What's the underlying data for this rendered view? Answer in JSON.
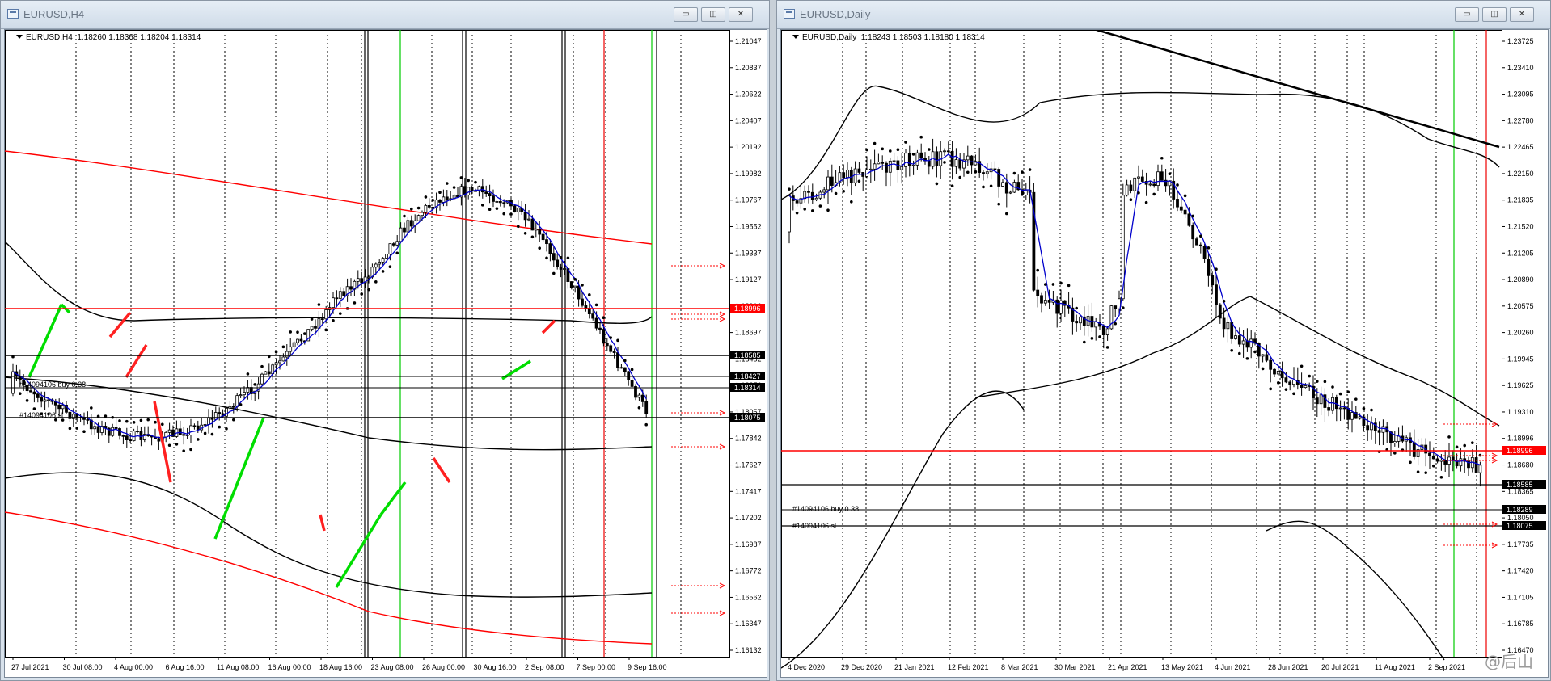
{
  "windows": [
    {
      "title": "EURUSD,H4",
      "header": "EURUSD,H4  1.18260 1.18368 1.18204 1.18314",
      "price_axis": [
        "1.21047",
        "1.20837",
        "1.20622",
        "1.20407",
        "1.20192",
        "1.19982",
        "1.19767",
        "1.19552",
        "1.19337",
        "1.19127",
        "1.18912",
        "1.18697",
        "1.18482",
        "1.18272",
        "1.18057",
        "1.17842",
        "1.17627",
        "1.17417",
        "1.17202",
        "1.16987",
        "1.16772",
        "1.16562",
        "1.16347",
        "1.16132"
      ],
      "price_tags": [
        {
          "text": "1.18996",
          "color": "#ff0000"
        },
        {
          "text": "1.18585",
          "color": "#000000"
        },
        {
          "text": "1.18427",
          "color": "#000000"
        },
        {
          "text": "1.18314",
          "color": "#000000"
        },
        {
          "text": "1.18075",
          "color": "#000000"
        }
      ],
      "order_labels": [
        "#14094106 buy 0.38",
        "#14094106 sl"
      ],
      "time_axis": [
        "27 Jul 2021",
        "30 Jul 08:00",
        "4 Aug 00:00",
        "6 Aug 16:00",
        "11 Aug 08:00",
        "16 Aug 00:00",
        "18 Aug 16:00",
        "23 Aug 08:00",
        "26 Aug 00:00",
        "30 Aug 16:00",
        "2 Sep 08:00",
        "7 Sep 00:00",
        "9 Sep 16:00"
      ]
    },
    {
      "title": "EURUSD,Daily",
      "header": "EURUSD,Daily  1.18243 1.18503 1.18180 1.18314",
      "price_axis": [
        "1.23725",
        "1.23410",
        "1.23095",
        "1.22780",
        "1.22465",
        "1.22150",
        "1.21835",
        "1.21520",
        "1.21205",
        "1.20890",
        "1.20575",
        "1.20260",
        "1.19945",
        "1.19625",
        "1.19310",
        "1.18996",
        "1.18680",
        "1.18365",
        "1.18050",
        "1.17735",
        "1.17420",
        "1.17105",
        "1.16785",
        "1.16470"
      ],
      "price_tags": [
        {
          "text": "1.18996",
          "color": "#ff0000"
        },
        {
          "text": "1.18585",
          "color": "#000000"
        },
        {
          "text": "1.18289",
          "color": "#000000"
        },
        {
          "text": "1.18075",
          "color": "#000000"
        }
      ],
      "order_labels": [
        "#14094106 buy 0.38",
        "#14094106 sl"
      ],
      "time_axis": [
        "4 Dec 2020",
        "29 Dec 2020",
        "21 Jan 2021",
        "12 Feb 2021",
        "8 Mar 2021",
        "30 Mar 2021",
        "21 Apr 2021",
        "13 May 2021",
        "4 Jun 2021",
        "28 Jun 2021",
        "20 Jul 2021",
        "11 Aug 2021",
        "2 Sep 2021"
      ]
    }
  ],
  "window_buttons": {
    "minimize": "▭",
    "restore": "◫",
    "close": "✕"
  },
  "watermark": "@后山",
  "colors": {
    "up_swing": "#00dd00",
    "down_swing": "#ff2020",
    "ma": "#0000cc",
    "psar": "#000000",
    "level_red": "#ff0000",
    "level_black": "#000000",
    "vline_green": "#00cc00",
    "vline_red": "#ee0000"
  }
}
